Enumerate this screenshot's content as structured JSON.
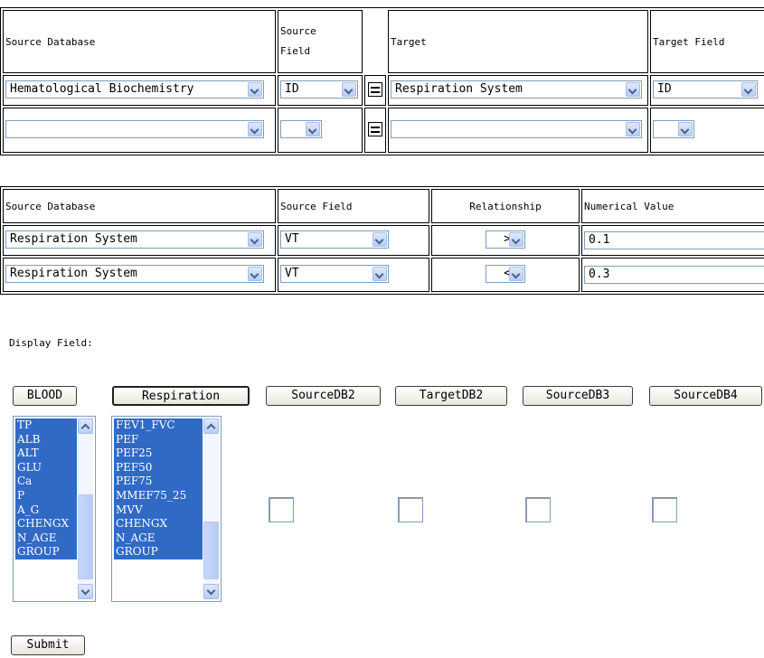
{
  "join": {
    "headers": [
      "Source Database",
      "Source\nField",
      "Target",
      "Target Field"
    ],
    "header_source_field_line1": "Source",
    "header_source_field_line2": "Field",
    "rows": [
      {
        "source_db": "Hematological Biochemistry",
        "source_field": "ID",
        "target": "Respiration System",
        "target_field": "ID"
      },
      {
        "source_db": "",
        "source_field": "",
        "target": "",
        "target_field": ""
      }
    ]
  },
  "filter": {
    "headers": [
      "Source Database",
      "Source Field",
      "Relationship",
      "Numerical Value"
    ],
    "rows": [
      {
        "source_db": "Respiration System",
        "source_field": "VT",
        "relationship": ">",
        "value": "0.1"
      },
      {
        "source_db": "Respiration System",
        "source_field": "VT",
        "relationship": "<",
        "value": "0.3"
      }
    ]
  },
  "display_label": "Display Field:",
  "buttons": [
    "BLOOD",
    "Respiration",
    "SourceDB2",
    "TargetDB2",
    "SourceDB3",
    "SourceDB4"
  ],
  "lists": {
    "blood": [
      "TP",
      "ALB",
      "ALT",
      "GLU",
      "Ca",
      "P",
      "A_G",
      "CHENGX",
      "N_AGE",
      "GROUP"
    ],
    "respiration": [
      "FEV1_FVC",
      "PEF",
      "PEF25",
      "PEF50",
      "PEF75",
      "MMEF75_25",
      "MVV",
      "CHENGX",
      "N_AGE",
      "GROUP"
    ]
  },
  "submit_label": "Submit",
  "colors": {
    "selection": "#316ac5",
    "border": "#7f9db9"
  }
}
